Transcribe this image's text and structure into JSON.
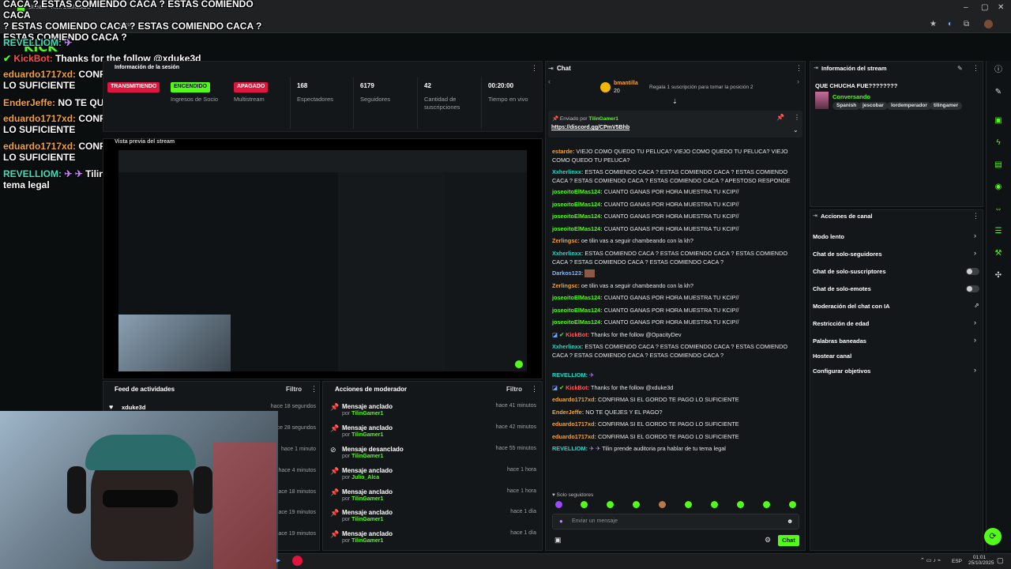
{
  "browser": {
    "tab_title": "Stream - Kick Dashboard",
    "url_fragment": "stream",
    "window_controls": [
      "–",
      "▢",
      "✕"
    ]
  },
  "overlay": {
    "brand": "KICK",
    "top_banner": [
      "CACA ? ESTAS COMIENDO CACA ? ESTAS COMIENDO CACA",
      "? ESTAS COMIENDO CACA ? ESTAS COMIENDO CACA ?",
      "ESTAS COMIENDO CACA ?"
    ],
    "messages": [
      {
        "user": "REVELLIOM:",
        "text": ""
      },
      {
        "user": "KickBot:",
        "text": "Thanks for the follow @xduke3d"
      },
      {
        "user": "eduardo1717xd:",
        "text": "CONFIRMA SI EL GORDO TE PAGO LO SUFICIENTE"
      },
      {
        "user": "EnderJeffe:",
        "text": "NO TE QUEJES Y EL PAGO?"
      },
      {
        "user": "eduardo1717xd:",
        "text": "CONFIRMA SI EL GORDO TE PAGO LO SUFICIENTE"
      },
      {
        "user": "eduardo1717xd:",
        "text": "CONFIRMA SI EL GORDO TE PAGO LO SUFICIENTE"
      },
      {
        "user": "REVELLIOM:",
        "text": "Tilin prende auditoria pra hablar de tu tema legal"
      }
    ]
  },
  "dashboard": {
    "session_info_title": "Información de la sesión",
    "status": {
      "streaming_label": "TRANSMITIENDO",
      "on_label": "ENCENDIDO",
      "off_label": "APAGADO",
      "partner_income_label": "Ingresos de Socio",
      "multistream_label": "Multistream"
    },
    "stats": [
      {
        "value": "168",
        "label": "Espectadores"
      },
      {
        "value": "6179",
        "label": "Seguidores"
      },
      {
        "value": "42",
        "label": "Cantidad de suscripciones"
      },
      {
        "value": "00:20:00",
        "label": "Tiempo en vivo"
      }
    ],
    "preview_title": "Vista previa del stream",
    "activity": {
      "title": "Feed de actividades",
      "filter": "Filtro",
      "items": [
        {
          "user": "xduke3d",
          "time": "hace 18 segundos"
        },
        {
          "user": "",
          "time": "hace 28 segundos"
        },
        {
          "user": "",
          "time": "hace 1 minuto"
        },
        {
          "user": "",
          "time": "hace 4 minutos"
        },
        {
          "user": "",
          "time": "hace 18 minutos"
        },
        {
          "user": "",
          "time": "hace 19 minutos"
        },
        {
          "user": "",
          "time": "hace 19 minutos"
        }
      ]
    },
    "moderator": {
      "title": "Acciones de moderador",
      "filter": "Filtro",
      "items": [
        {
          "action": "Mensaje anclado",
          "by_prefix": "por",
          "by": "TilinGamer1",
          "time": "hace 41 minutos"
        },
        {
          "action": "Mensaje anclado",
          "by_prefix": "por",
          "by": "TilinGamer1",
          "time": "hace 42 minutos"
        },
        {
          "action": "Mensaje desanclado",
          "by_prefix": "por",
          "by": "TilinGamer1",
          "time": "hace 55 minutos"
        },
        {
          "action": "Mensaje anclado",
          "by_prefix": "por",
          "by": "Julio_Alca",
          "time": "hace 1 hora"
        },
        {
          "action": "Mensaje anclado",
          "by_prefix": "por",
          "by": "TilinGamer1",
          "time": "hace 1 hora"
        },
        {
          "action": "Mensaje anclado",
          "by_prefix": "por",
          "by": "TilinGamer1",
          "time": "hace 1 día"
        },
        {
          "action": "Mensaje anclado",
          "by_prefix": "por",
          "by": "TilinGamer1",
          "time": "hace 1 día"
        }
      ]
    }
  },
  "chat": {
    "title": "Chat",
    "top_gifter": {
      "name": "bmantilla",
      "count": "20"
    },
    "gift_prompt": "Regala 1 suscripción para tomar la posición 2",
    "pinned": {
      "label": "Enviado por",
      "user": "TilinGamer1",
      "link": "https://discord.gg/CPmV5Bhb"
    },
    "messages": [
      {
        "user": "estarde:",
        "text": "VIEJO COMO QUEDO TU PELUCA? VIEJO COMO QUEDO TU PELUCA? VIEJO COMO QUEDO TU PELUCA?",
        "color": "orange"
      },
      {
        "user": "Xxherlinxx:",
        "text": "ESTAS COMIENDO CACA ? ESTAS COMIENDO CACA ? ESTAS COMIENDO CACA ? ESTAS COMIENDO CACA ? ESTAS COMIENDO CACA ? APESTOSO RESPONDE",
        "color": "teal"
      },
      {
        "user": "joseoitoElMas124:",
        "text": "CUANTO GANAS POR HORA MUESTRA TU KCIP//",
        "color": "green"
      },
      {
        "user": "joseoitoElMas124:",
        "text": "CUANTO GANAS POR HORA MUESTRA TU KCIP//",
        "color": "green"
      },
      {
        "user": "joseoitoElMas124:",
        "text": "CUANTO GANAS POR HORA MUESTRA TU KCIP//",
        "color": "green"
      },
      {
        "user": "joseoitoElMas124:",
        "text": "CUANTO GANAS POR HORA MUESTRA TU KCIP//",
        "color": "green"
      },
      {
        "user": "Zerlingsc:",
        "text": "oe tilin vas a seguir chambeando con la kh?",
        "color": "orange"
      },
      {
        "user": "Xxherlinxx:",
        "text": "ESTAS COMIENDO CACA ? ESTAS COMIENDO CACA ? ESTAS COMIENDO CACA ? ESTAS COMIENDO CACA ? ESTAS COMIENDO CACA ?",
        "color": "teal"
      },
      {
        "user": "Darkos123:",
        "text": "",
        "color": "blue"
      },
      {
        "user": "Zerlingsc:",
        "text": "oe tilin vas a seguir chambeando con la kh?",
        "color": "orange"
      },
      {
        "user": "joseoitoElMas124:",
        "text": "CUANTO GANAS POR HORA MUESTRA TU KCIP//",
        "color": "green"
      },
      {
        "user": "joseoitoElMas124:",
        "text": "CUANTO GANAS POR HORA MUESTRA TU KCIP//",
        "color": "green"
      },
      {
        "user": "joseoitoElMas124:",
        "text": "CUANTO GANAS POR HORA MUESTRA TU KCIP//",
        "color": "green"
      },
      {
        "user": "KickBot:",
        "text": "Thanks for the follow @OpacityDev",
        "color": "red"
      },
      {
        "user": "Xxherlinxx:",
        "text": "ESTAS COMIENDO CACA ? ESTAS COMIENDO CACA ? ESTAS COMIENDO CACA ? ESTAS COMIENDO CACA ? ESTAS COMIENDO CACA ?",
        "color": "teal"
      },
      {
        "user": "REVELLIOM:",
        "text": "",
        "color": "teal"
      },
      {
        "user": "KickBot:",
        "text": "Thanks for the follow @xduke3d",
        "color": "red"
      },
      {
        "user": "eduardo1717xd:",
        "text": "CONFIRMA SI EL GORDO TE PAGO LO SUFICIENTE",
        "color": "orange"
      },
      {
        "user": "EnderJeffe:",
        "text": "NO TE QUEJES Y EL PAGO?",
        "color": "orange"
      },
      {
        "user": "eduardo1717xd:",
        "text": "CONFIRMA SI EL GORDO TE PAGO LO SUFICIENTE",
        "color": "orange"
      },
      {
        "user": "eduardo1717xd:",
        "text": "CONFIRMA SI EL GORDO TE PAGO LO SUFICIENTE",
        "color": "orange"
      },
      {
        "user": "REVELLIOM:",
        "text": "Tilin prende auditoria pra hablar de tu tema legal",
        "color": "teal"
      }
    ],
    "followers_only": "Solo seguidores",
    "input_placeholder": "Enviar un mensaje",
    "send_label": "Chat"
  },
  "stream_info": {
    "title": "Información del stream",
    "stream_title": "QUE CHUCHA FUE????????",
    "category": "Conversando",
    "tags": [
      "Spanish",
      "jescobar",
      "lordemperador",
      "tilingamer"
    ]
  },
  "channel_actions": {
    "title": "Acciones de canal",
    "items": [
      {
        "label": "Modo lento",
        "control": "chevron"
      },
      {
        "label": "Chat de solo-seguidores",
        "control": "chevron"
      },
      {
        "label": "Chat de solo-suscriptores",
        "control": "toggle"
      },
      {
        "label": "Chat de solo-emotes",
        "control": "toggle"
      },
      {
        "label": "Moderación del chat con IA",
        "control": "link"
      },
      {
        "label": "Restricción de edad",
        "control": "chevron"
      },
      {
        "label": "Palabras baneadas",
        "control": "chevron"
      },
      {
        "label": "Hostear canal",
        "control": "none"
      },
      {
        "label": "Configurar objetivos",
        "control": "chevron"
      }
    ]
  },
  "taskbar": {
    "lang": "ESP",
    "time": "01:01",
    "date": "25/10/2025"
  },
  "colors": {
    "kick_green": "#53fc18",
    "live_red": "#e0143c",
    "bg": "#0b0e0f",
    "panel": "#141719"
  }
}
